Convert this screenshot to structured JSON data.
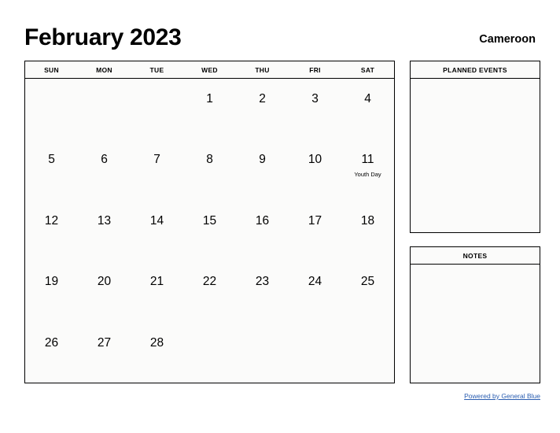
{
  "header": {
    "month_title": "February 2023",
    "country": "Cameroon"
  },
  "calendar": {
    "day_headers": [
      "SUN",
      "MON",
      "TUE",
      "WED",
      "THU",
      "FRI",
      "SAT"
    ],
    "weeks": [
      [
        {
          "day": ""
        },
        {
          "day": ""
        },
        {
          "day": ""
        },
        {
          "day": "1"
        },
        {
          "day": "2"
        },
        {
          "day": "3"
        },
        {
          "day": "4"
        }
      ],
      [
        {
          "day": "5"
        },
        {
          "day": "6"
        },
        {
          "day": "7"
        },
        {
          "day": "8"
        },
        {
          "day": "9"
        },
        {
          "day": "10"
        },
        {
          "day": "11",
          "event": "Youth Day"
        }
      ],
      [
        {
          "day": "12"
        },
        {
          "day": "13"
        },
        {
          "day": "14"
        },
        {
          "day": "15"
        },
        {
          "day": "16"
        },
        {
          "day": "17"
        },
        {
          "day": "18"
        }
      ],
      [
        {
          "day": "19"
        },
        {
          "day": "20"
        },
        {
          "day": "21"
        },
        {
          "day": "22"
        },
        {
          "day": "23"
        },
        {
          "day": "24"
        },
        {
          "day": "25"
        }
      ],
      [
        {
          "day": "26"
        },
        {
          "day": "27"
        },
        {
          "day": "28"
        },
        {
          "day": ""
        },
        {
          "day": ""
        },
        {
          "day": ""
        },
        {
          "day": ""
        }
      ]
    ]
  },
  "panels": {
    "planned_events_title": "PLANNED EVENTS",
    "planned_events_body": "",
    "notes_title": "NOTES",
    "notes_body": ""
  },
  "footer": {
    "link_text": "Powered by General Blue",
    "link_color": "#2a5db0"
  }
}
